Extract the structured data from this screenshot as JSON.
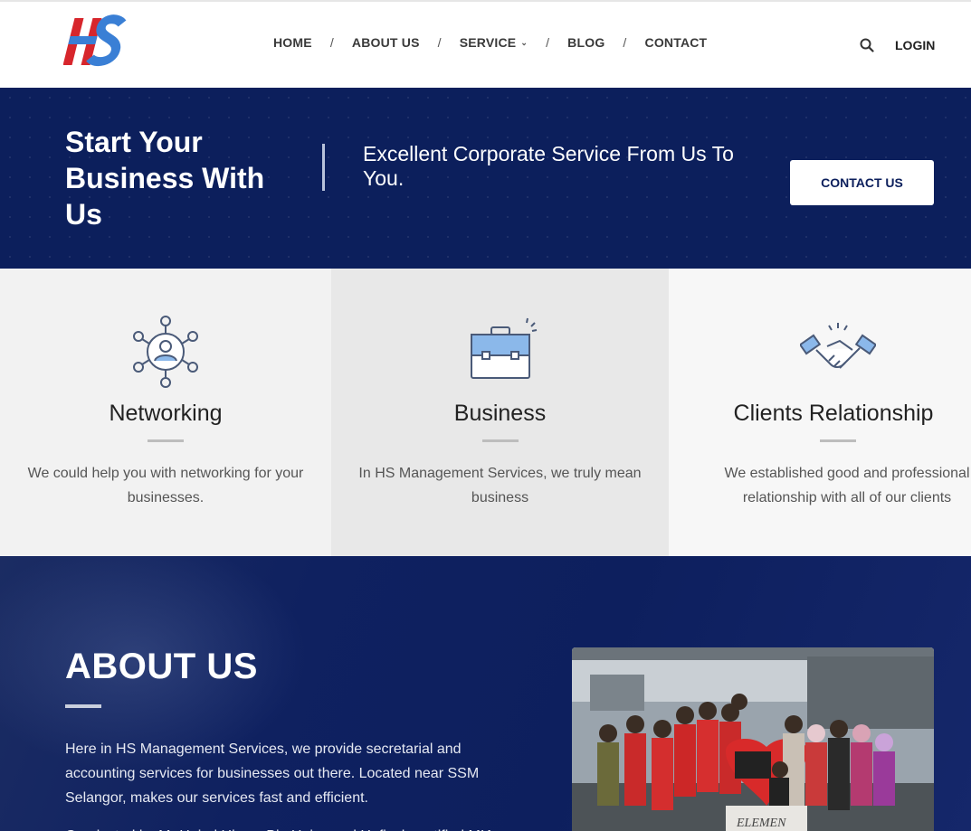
{
  "header": {
    "logo_text": "HS",
    "nav": [
      {
        "label": "HOME"
      },
      {
        "label": "ABOUT US"
      },
      {
        "label": "SERVICE"
      },
      {
        "label": "BLOG"
      },
      {
        "label": "CONTACT"
      }
    ],
    "separator": "/",
    "search_icon": "search-icon",
    "login_label": "LOGIN"
  },
  "hero": {
    "title": "Start Your Business With Us",
    "subtitle": "Excellent Corporate Service From Us To You.",
    "button_label": "CONTACT US"
  },
  "features": [
    {
      "icon": "network-icon",
      "title": "Networking",
      "description": "We could help you with networking for your businesses."
    },
    {
      "icon": "briefcase-icon",
      "title": "Business",
      "description": "In HS Management Services, we truly mean business"
    },
    {
      "icon": "handshake-icon",
      "title": "Clients Relationship",
      "description": "We established good and professional relationship with all of our clients"
    }
  ],
  "about": {
    "title": "ABOUT US",
    "text": "Here in HS Management Services, we provide secretarial and accounting services for businesses out there. Located near SSM Selangor, makes our services fast and efficient.",
    "text2": "Conducted by Mr Hairul Hisam Bin Haiza and Hafizah certified MIA"
  },
  "colors": {
    "navy": "#0c1f5c",
    "logo_red": "#d7262c",
    "logo_blue": "#3a7fd5",
    "icon_blue": "#8bb8ea"
  }
}
